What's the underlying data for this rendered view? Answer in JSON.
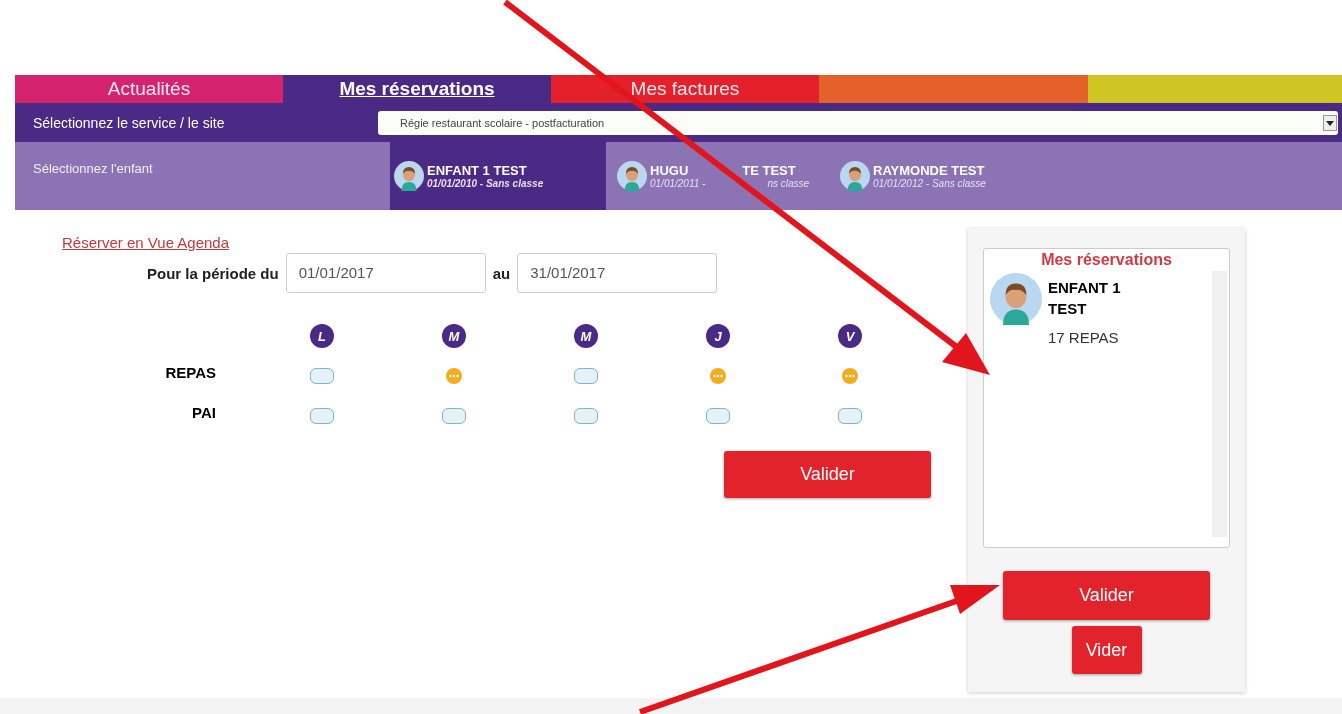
{
  "tabs": [
    {
      "label": "Actualités",
      "selected": false,
      "color": "#d4236f"
    },
    {
      "label": "Mes réservations",
      "selected": true,
      "color": "#4b2a85"
    },
    {
      "label": "Mes factures",
      "selected": false,
      "color": "#e4202a"
    }
  ],
  "color_bands": [
    {
      "color": "#e5612a"
    },
    {
      "color": "#cfc523"
    }
  ],
  "service": {
    "label": "Sélectionnez le service / le site",
    "value": "Régie restaurant scolaire - postfacturation"
  },
  "children_bar": {
    "label": "Sélectionnez l'enfant",
    "children": [
      {
        "name": [
          "ENFANT 1 TEST"
        ],
        "info": [
          "01/01/2010 - Sans classe"
        ],
        "selected": true
      },
      {
        "name": [
          "HUGU",
          "TE TEST"
        ],
        "info": [
          "01/01/2011 -",
          "ns classe"
        ],
        "selected": false
      },
      {
        "name": [
          "RAYMONDE TEST"
        ],
        "info": [
          "01/01/2012 - Sans classe"
        ],
        "selected": false
      }
    ]
  },
  "agenda_link": "Réserver en Vue Agenda",
  "period": {
    "label": "Pour la période du",
    "from": "01/01/2017",
    "to_label": "au",
    "to": "31/01/2017"
  },
  "days": [
    "L",
    "M",
    "M",
    "J",
    "V"
  ],
  "rows": [
    {
      "label": "REPAS",
      "cells": [
        {
          "booked": false
        },
        {
          "booked": true
        },
        {
          "booked": false
        },
        {
          "booked": true
        },
        {
          "booked": true
        }
      ]
    },
    {
      "label": "PAI",
      "cells": [
        {
          "booked": false
        },
        {
          "booked": false
        },
        {
          "booked": false
        },
        {
          "booked": false
        },
        {
          "booked": false
        }
      ]
    }
  ],
  "validate_button": "Valider",
  "summary": {
    "title": "Mes réservations",
    "child": "ENFANT 1 TEST",
    "count": "17 REPAS",
    "validate_button": "Valider",
    "clear_button": "Vider"
  }
}
